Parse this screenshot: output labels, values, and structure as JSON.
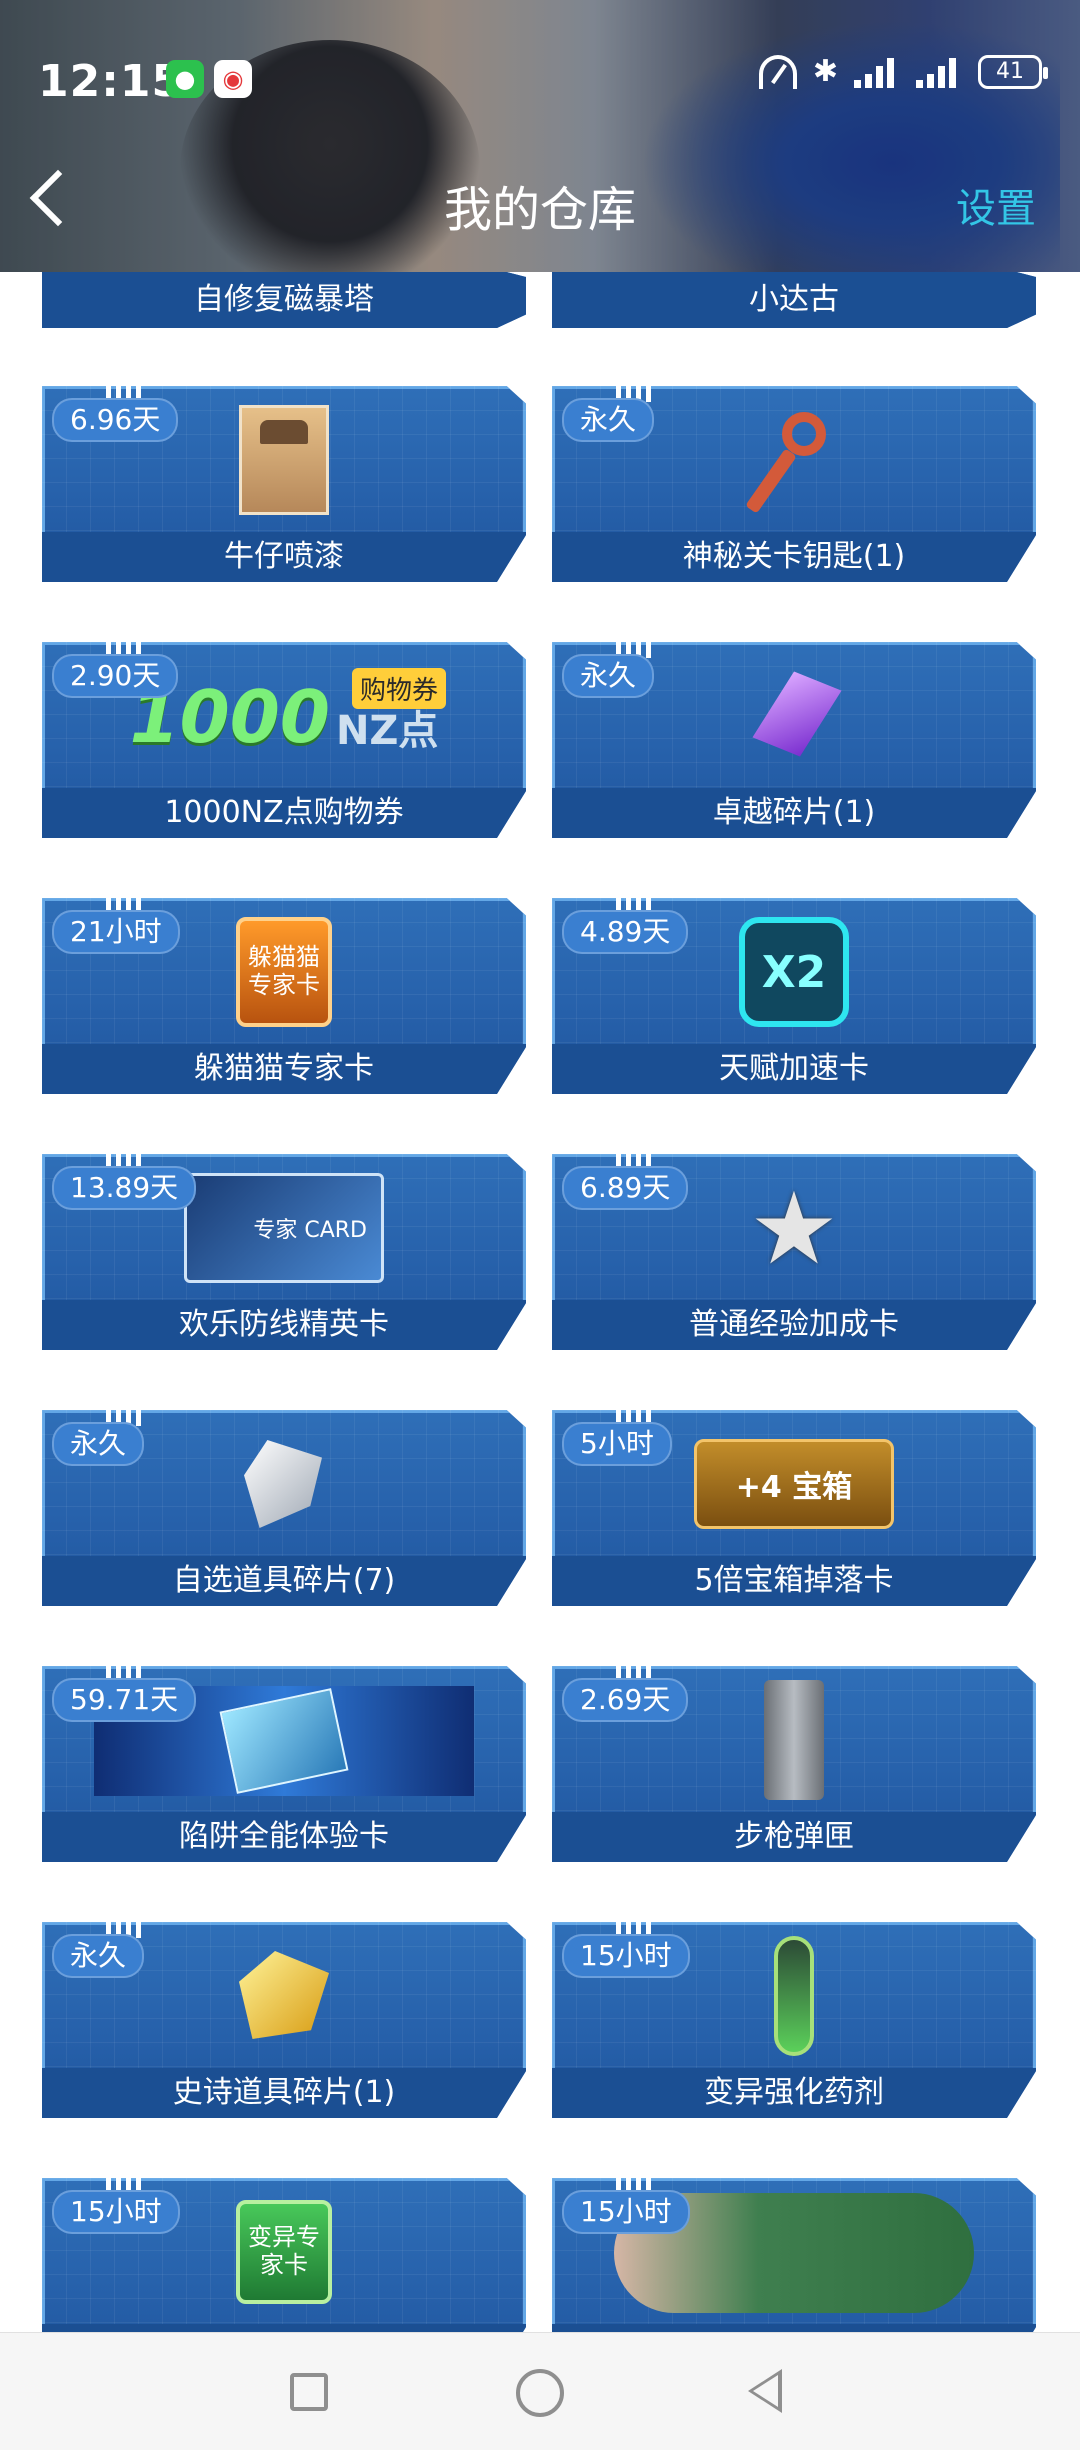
{
  "status": {
    "time": "12:15",
    "battery": "41"
  },
  "header": {
    "title": "我的仓库",
    "settings": "设置"
  },
  "top_row": [
    {
      "name": "自修复磁暴塔"
    },
    {
      "name": "小达古"
    }
  ],
  "items": [
    {
      "badge": "6.96天",
      "name": "牛仔喷漆"
    },
    {
      "badge": "永久",
      "name": "神秘关卡钥匙(1)"
    },
    {
      "badge": "2.90天",
      "name": "1000NZ点购物券",
      "art_1000": "1000",
      "art_nz": "NZ点",
      "art_tag": "购物券"
    },
    {
      "badge": "永久",
      "name": "卓越碎片(1)"
    },
    {
      "badge": "21小时",
      "name": "躲猫猫专家卡",
      "art": "躲猫猫专家卡"
    },
    {
      "badge": "4.89天",
      "name": "天赋加速卡",
      "art": "X2"
    },
    {
      "badge": "13.89天",
      "name": "欢乐防线精英卡",
      "art": "专家 CARD"
    },
    {
      "badge": "6.89天",
      "name": "普通经验加成卡",
      "art": "★"
    },
    {
      "badge": "永久",
      "name": "自选道具碎片(7)"
    },
    {
      "badge": "5小时",
      "name": "5倍宝箱掉落卡",
      "art": "+4 宝箱"
    },
    {
      "badge": "59.71天",
      "name": "陷阱全能体验卡"
    },
    {
      "badge": "2.69天",
      "name": "步枪弹匣"
    },
    {
      "badge": "永久",
      "name": "史诗道具碎片(1)"
    },
    {
      "badge": "15小时",
      "name": "变异强化药剂"
    },
    {
      "badge": "15小时",
      "name": "",
      "art": "变异专家卡"
    },
    {
      "badge": "15小时",
      "name": ""
    }
  ]
}
